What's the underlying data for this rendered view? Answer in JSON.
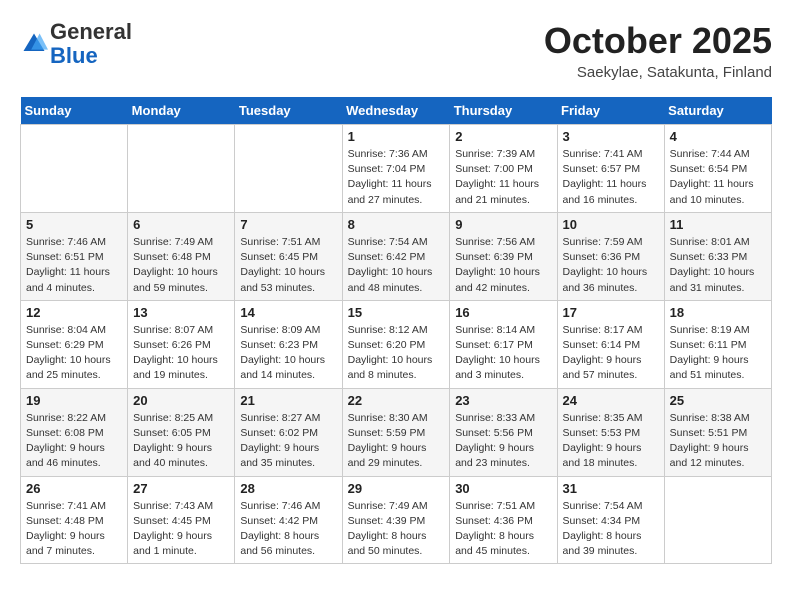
{
  "logo": {
    "general": "General",
    "blue": "Blue"
  },
  "title": "October 2025",
  "subtitle": "Saekylae, Satakunta, Finland",
  "weekdays": [
    "Sunday",
    "Monday",
    "Tuesday",
    "Wednesday",
    "Thursday",
    "Friday",
    "Saturday"
  ],
  "weeks": [
    [
      {
        "day": "",
        "info": ""
      },
      {
        "day": "",
        "info": ""
      },
      {
        "day": "",
        "info": ""
      },
      {
        "day": "1",
        "info": "Sunrise: 7:36 AM\nSunset: 7:04 PM\nDaylight: 11 hours\nand 27 minutes."
      },
      {
        "day": "2",
        "info": "Sunrise: 7:39 AM\nSunset: 7:00 PM\nDaylight: 11 hours\nand 21 minutes."
      },
      {
        "day": "3",
        "info": "Sunrise: 7:41 AM\nSunset: 6:57 PM\nDaylight: 11 hours\nand 16 minutes."
      },
      {
        "day": "4",
        "info": "Sunrise: 7:44 AM\nSunset: 6:54 PM\nDaylight: 11 hours\nand 10 minutes."
      }
    ],
    [
      {
        "day": "5",
        "info": "Sunrise: 7:46 AM\nSunset: 6:51 PM\nDaylight: 11 hours\nand 4 minutes."
      },
      {
        "day": "6",
        "info": "Sunrise: 7:49 AM\nSunset: 6:48 PM\nDaylight: 10 hours\nand 59 minutes."
      },
      {
        "day": "7",
        "info": "Sunrise: 7:51 AM\nSunset: 6:45 PM\nDaylight: 10 hours\nand 53 minutes."
      },
      {
        "day": "8",
        "info": "Sunrise: 7:54 AM\nSunset: 6:42 PM\nDaylight: 10 hours\nand 48 minutes."
      },
      {
        "day": "9",
        "info": "Sunrise: 7:56 AM\nSunset: 6:39 PM\nDaylight: 10 hours\nand 42 minutes."
      },
      {
        "day": "10",
        "info": "Sunrise: 7:59 AM\nSunset: 6:36 PM\nDaylight: 10 hours\nand 36 minutes."
      },
      {
        "day": "11",
        "info": "Sunrise: 8:01 AM\nSunset: 6:33 PM\nDaylight: 10 hours\nand 31 minutes."
      }
    ],
    [
      {
        "day": "12",
        "info": "Sunrise: 8:04 AM\nSunset: 6:29 PM\nDaylight: 10 hours\nand 25 minutes."
      },
      {
        "day": "13",
        "info": "Sunrise: 8:07 AM\nSunset: 6:26 PM\nDaylight: 10 hours\nand 19 minutes."
      },
      {
        "day": "14",
        "info": "Sunrise: 8:09 AM\nSunset: 6:23 PM\nDaylight: 10 hours\nand 14 minutes."
      },
      {
        "day": "15",
        "info": "Sunrise: 8:12 AM\nSunset: 6:20 PM\nDaylight: 10 hours\nand 8 minutes."
      },
      {
        "day": "16",
        "info": "Sunrise: 8:14 AM\nSunset: 6:17 PM\nDaylight: 10 hours\nand 3 minutes."
      },
      {
        "day": "17",
        "info": "Sunrise: 8:17 AM\nSunset: 6:14 PM\nDaylight: 9 hours\nand 57 minutes."
      },
      {
        "day": "18",
        "info": "Sunrise: 8:19 AM\nSunset: 6:11 PM\nDaylight: 9 hours\nand 51 minutes."
      }
    ],
    [
      {
        "day": "19",
        "info": "Sunrise: 8:22 AM\nSunset: 6:08 PM\nDaylight: 9 hours\nand 46 minutes."
      },
      {
        "day": "20",
        "info": "Sunrise: 8:25 AM\nSunset: 6:05 PM\nDaylight: 9 hours\nand 40 minutes."
      },
      {
        "day": "21",
        "info": "Sunrise: 8:27 AM\nSunset: 6:02 PM\nDaylight: 9 hours\nand 35 minutes."
      },
      {
        "day": "22",
        "info": "Sunrise: 8:30 AM\nSunset: 5:59 PM\nDaylight: 9 hours\nand 29 minutes."
      },
      {
        "day": "23",
        "info": "Sunrise: 8:33 AM\nSunset: 5:56 PM\nDaylight: 9 hours\nand 23 minutes."
      },
      {
        "day": "24",
        "info": "Sunrise: 8:35 AM\nSunset: 5:53 PM\nDaylight: 9 hours\nand 18 minutes."
      },
      {
        "day": "25",
        "info": "Sunrise: 8:38 AM\nSunset: 5:51 PM\nDaylight: 9 hours\nand 12 minutes."
      }
    ],
    [
      {
        "day": "26",
        "info": "Sunrise: 7:41 AM\nSunset: 4:48 PM\nDaylight: 9 hours\nand 7 minutes."
      },
      {
        "day": "27",
        "info": "Sunrise: 7:43 AM\nSunset: 4:45 PM\nDaylight: 9 hours\nand 1 minute."
      },
      {
        "day": "28",
        "info": "Sunrise: 7:46 AM\nSunset: 4:42 PM\nDaylight: 8 hours\nand 56 minutes."
      },
      {
        "day": "29",
        "info": "Sunrise: 7:49 AM\nSunset: 4:39 PM\nDaylight: 8 hours\nand 50 minutes."
      },
      {
        "day": "30",
        "info": "Sunrise: 7:51 AM\nSunset: 4:36 PM\nDaylight: 8 hours\nand 45 minutes."
      },
      {
        "day": "31",
        "info": "Sunrise: 7:54 AM\nSunset: 4:34 PM\nDaylight: 8 hours\nand 39 minutes."
      },
      {
        "day": "",
        "info": ""
      }
    ]
  ]
}
